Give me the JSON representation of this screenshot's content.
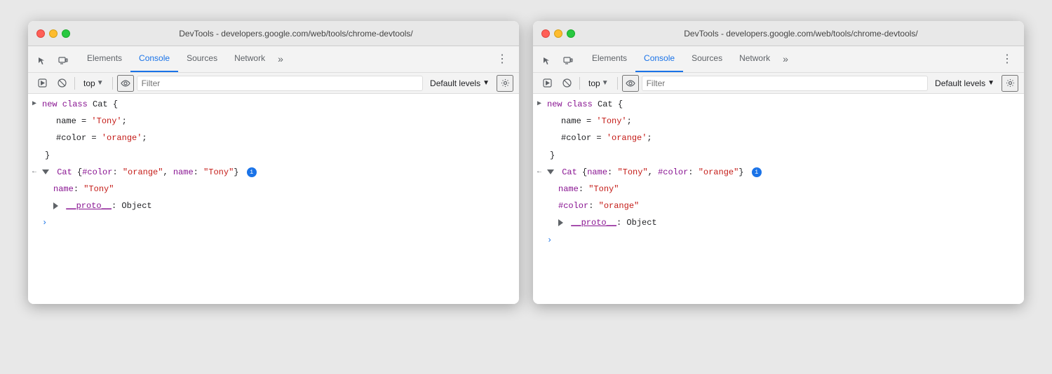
{
  "windows": [
    {
      "id": "window-left",
      "titleBar": {
        "text": "DevTools - developers.google.com/web/tools/chrome-devtools/"
      },
      "tabs": {
        "items": [
          "Elements",
          "Console",
          "Sources",
          "Network"
        ],
        "active": "Console",
        "more": "»",
        "menuIcon": "⋮"
      },
      "toolbar": {
        "runIcon": "▶",
        "blockIcon": "🚫",
        "contextLabel": "top",
        "eyeLabel": "👁",
        "filterPlaceholder": "Filter",
        "levelsLabel": "Default levels",
        "gearLabel": "⚙"
      },
      "console": {
        "entries": [
          {
            "type": "input",
            "lines": [
              "new class Cat {",
              "    name = 'Tony';",
              "    #color = 'orange';",
              "}"
            ]
          },
          {
            "type": "output-expanded",
            "summary": "▼ Cat {#color: \"orange\", name: \"Tony\"}",
            "properties": [
              "name: \"Tony\"",
              "▶ __proto__: Object"
            ]
          },
          {
            "type": "prompt"
          }
        ]
      }
    },
    {
      "id": "window-right",
      "titleBar": {
        "text": "DevTools - developers.google.com/web/tools/chrome-devtools/"
      },
      "tabs": {
        "items": [
          "Elements",
          "Console",
          "Sources",
          "Network"
        ],
        "active": "Console",
        "more": "»",
        "menuIcon": "⋮"
      },
      "toolbar": {
        "runIcon": "▶",
        "blockIcon": "🚫",
        "contextLabel": "top",
        "eyeLabel": "👁",
        "filterPlaceholder": "Filter",
        "levelsLabel": "Default levels",
        "gearLabel": "⚙"
      },
      "console": {
        "entries": [
          {
            "type": "input",
            "lines": [
              "new class Cat {",
              "    name = 'Tony';",
              "    #color = 'orange';",
              "}"
            ]
          },
          {
            "type": "output-expanded",
            "summary": "▼ Cat {name: \"Tony\", #color: \"orange\"}",
            "properties": [
              "name: \"Tony\"",
              "#color: \"orange\"",
              "▶ __proto__: Object"
            ]
          },
          {
            "type": "prompt"
          }
        ]
      }
    }
  ]
}
